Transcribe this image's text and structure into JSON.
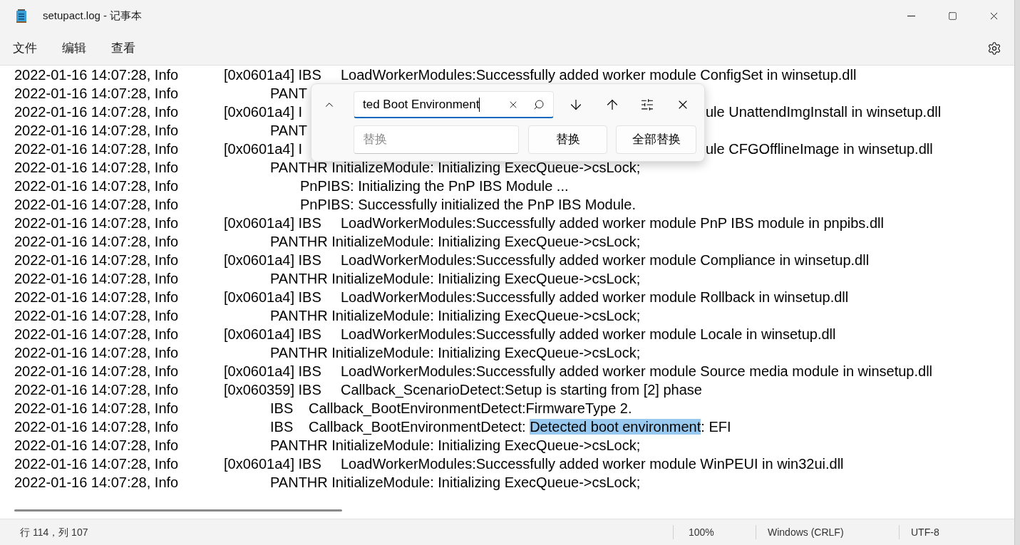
{
  "window": {
    "title": "setupact.log - 记事本"
  },
  "menu": [
    {
      "label": "文件"
    },
    {
      "label": "编辑"
    },
    {
      "label": "查看"
    }
  ],
  "lines": [
    {
      "time": "2022-01-16 14:07:28, Info",
      "kind": "bracketed",
      "source": "[0x0601a4] IBS",
      "message": "LoadWorkerModules:Successfully added worker module ConfigSet in winsetup.dll"
    },
    {
      "time": "2022-01-16 14:07:28, Info",
      "kind": "panthr",
      "message": "PANT"
    },
    {
      "time": "2022-01-16 14:07:28, Info",
      "kind": "bracketed",
      "source": "[0x0601a4] I",
      "right": "ule UnattendImgInstall in winsetup.dll"
    },
    {
      "time": "2022-01-16 14:07:28, Info",
      "kind": "panthr",
      "message": "PANT"
    },
    {
      "time": "2022-01-16 14:07:28, Info",
      "kind": "bracketed",
      "source": "[0x0601a4] I",
      "right": "ule CFGOfflineImage in winsetup.dll"
    },
    {
      "time": "2022-01-16 14:07:28, Info",
      "kind": "panthr",
      "message": "PANTHR InitializeModule: Initializing ExecQueue->csLock;"
    },
    {
      "time": "2022-01-16 14:07:28, Info",
      "kind": "pnp",
      "message": "PnPIBS: Initializing the PnP IBS Module ..."
    },
    {
      "time": "2022-01-16 14:07:28, Info",
      "kind": "pnp",
      "message": "PnPIBS: Successfully initialized the PnP IBS Module."
    },
    {
      "time": "2022-01-16 14:07:28, Info",
      "kind": "bracketed",
      "source": "[0x0601a4] IBS",
      "message": "LoadWorkerModules:Successfully added worker module PnP IBS module in pnpibs.dll"
    },
    {
      "time": "2022-01-16 14:07:28, Info",
      "kind": "panthr",
      "message": "PANTHR InitializeModule: Initializing ExecQueue->csLock;"
    },
    {
      "time": "2022-01-16 14:07:28, Info",
      "kind": "bracketed",
      "source": "[0x0601a4] IBS",
      "message": "LoadWorkerModules:Successfully added worker module Compliance in winsetup.dll"
    },
    {
      "time": "2022-01-16 14:07:28, Info",
      "kind": "panthr",
      "message": "PANTHR InitializeModule: Initializing ExecQueue->csLock;"
    },
    {
      "time": "2022-01-16 14:07:28, Info",
      "kind": "bracketed",
      "source": "[0x0601a4] IBS",
      "message": "LoadWorkerModules:Successfully added worker module Rollback in winsetup.dll"
    },
    {
      "time": "2022-01-16 14:07:28, Info",
      "kind": "panthr",
      "message": "PANTHR InitializeModule: Initializing ExecQueue->csLock;"
    },
    {
      "time": "2022-01-16 14:07:28, Info",
      "kind": "bracketed",
      "source": "[0x0601a4] IBS",
      "message": "LoadWorkerModules:Successfully added worker module Locale in winsetup.dll"
    },
    {
      "time": "2022-01-16 14:07:28, Info",
      "kind": "panthr",
      "message": "PANTHR InitializeModule: Initializing ExecQueue->csLock;"
    },
    {
      "time": "2022-01-16 14:07:28, Info",
      "kind": "bracketed",
      "source": "[0x0601a4] IBS",
      "message": "LoadWorkerModules:Successfully added worker module Source media module in winsetup.dll"
    },
    {
      "time": "2022-01-16 14:07:28, Info",
      "kind": "bracketed",
      "source": "[0x060359] IBS",
      "message": "Callback_ScenarioDetect:Setup is starting from [2] phase"
    },
    {
      "time": "2022-01-16 14:07:28, Info",
      "kind": "ibs",
      "source": "IBS",
      "message": "Callback_BootEnvironmentDetect:FirmwareType 2."
    },
    {
      "time": "2022-01-16 14:07:28, Info",
      "kind": "ibs",
      "source": "IBS",
      "message_parts": [
        {
          "text": "Callback_BootEnvironmentDetect: ",
          "selected": false
        },
        {
          "text": "Detected boot environment",
          "selected": true
        },
        {
          "text": ": EFI",
          "selected": false
        }
      ]
    },
    {
      "time": "2022-01-16 14:07:28, Info",
      "kind": "panthr",
      "message": "PANTHR InitializeModule: Initializing ExecQueue->csLock;"
    },
    {
      "time": "2022-01-16 14:07:28, Info",
      "kind": "bracketed",
      "source": "[0x0601a4] IBS",
      "message": "LoadWorkerModules:Successfully added worker module WinPEUI in win32ui.dll"
    },
    {
      "time": "2022-01-16 14:07:28, Info",
      "kind": "panthr",
      "message": "PANTHR InitializeModule: Initializing ExecQueue->csLock;"
    }
  ],
  "find": {
    "search_value": "ted Boot Environment",
    "replace_placeholder": "替换",
    "buttons": [
      {
        "label": "替换"
      },
      {
        "label": "全部替换"
      }
    ]
  },
  "status_bar": {
    "position": "行 114，列 107",
    "zoom": "100%",
    "line_ending": "Windows (CRLF)",
    "encoding": "UTF-8"
  }
}
